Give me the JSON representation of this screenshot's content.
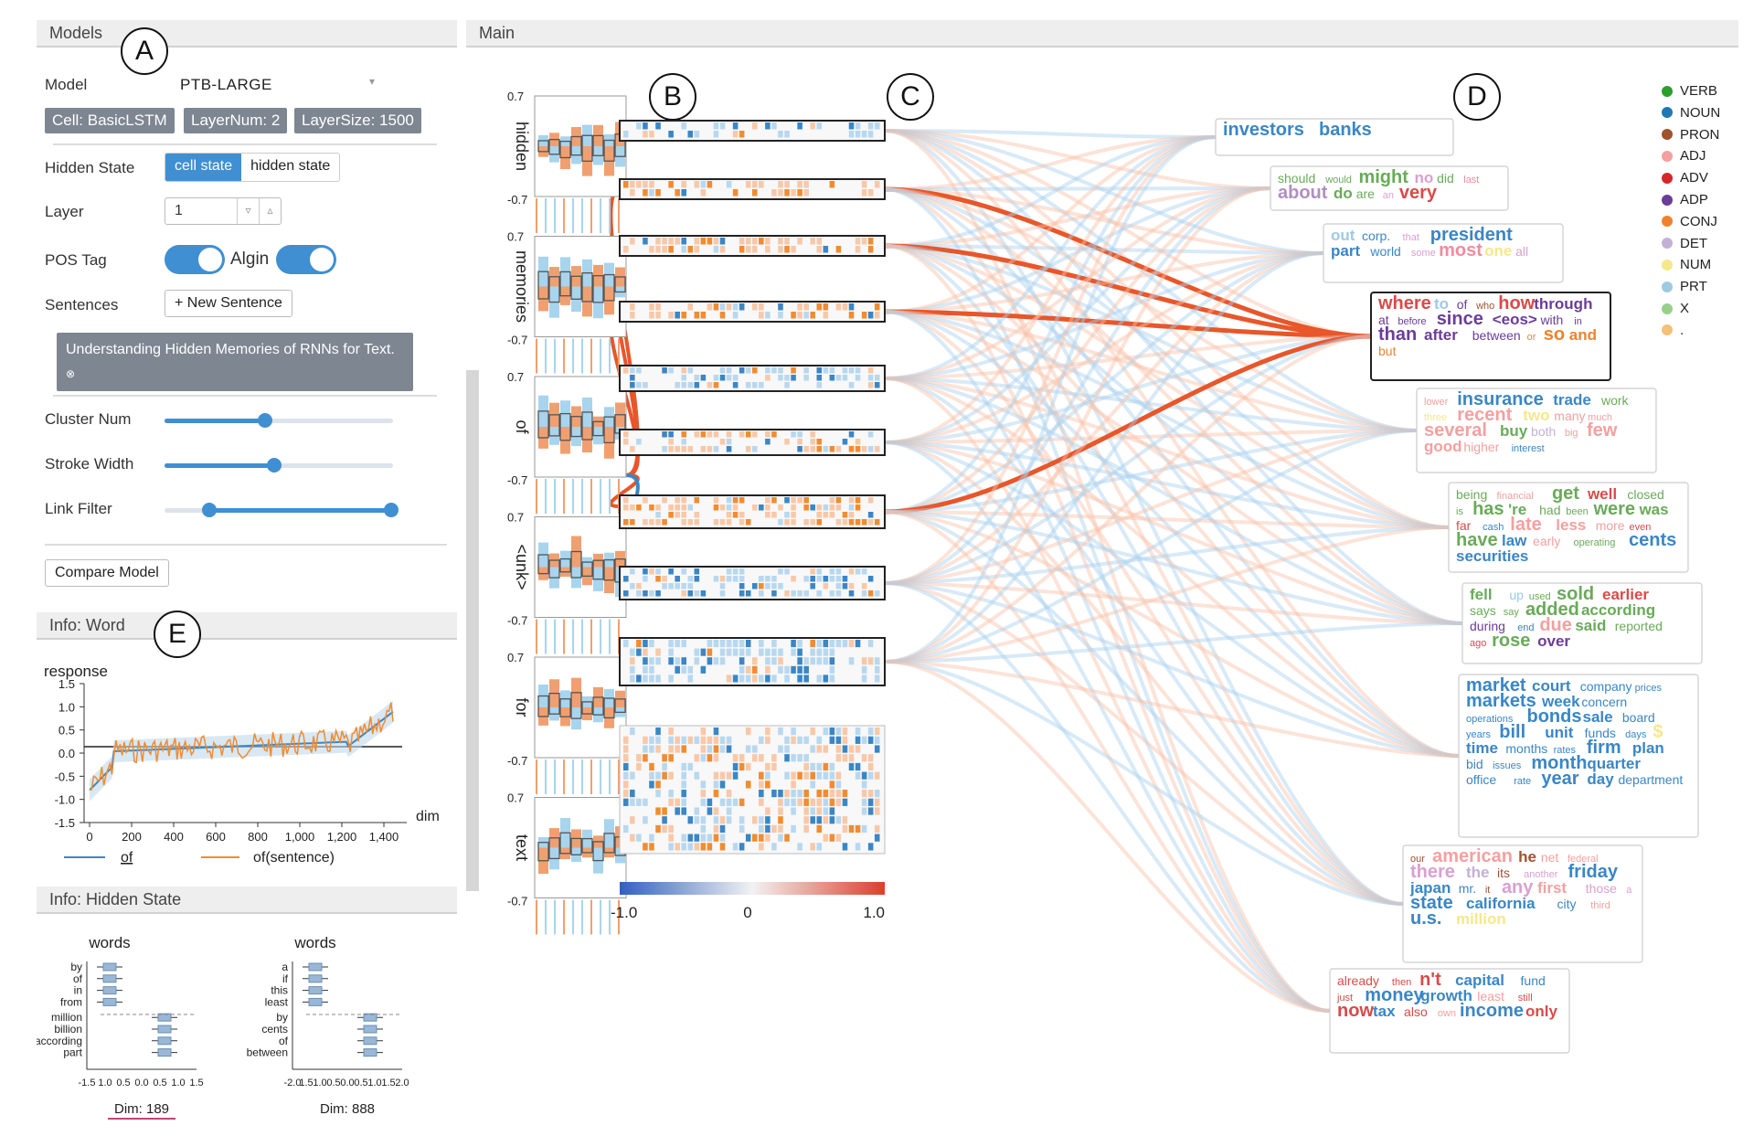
{
  "left": {
    "models_header": "Models",
    "label_a": "A",
    "model_label": "Model",
    "model_value": "PTB-LARGE",
    "chips": [
      "Cell: BasicLSTM",
      "LayerNum: 2",
      "LayerSize: 1500"
    ],
    "hidden_state_label": "Hidden State",
    "hidden_state_options": [
      "cell state",
      "hidden state"
    ],
    "layer_label": "Layer",
    "layer_value": "1",
    "pos_tag_label": "POS Tag",
    "align_label": "Algin",
    "sentences_label": "Sentences",
    "new_sentence_button": "+ New Sentence",
    "sentence_text": "Understanding Hidden Memories of RNNs for Text.",
    "cluster_num_label": "Cluster Num",
    "cluster_num_value": 0.44,
    "stroke_width_label": "Stroke Width",
    "stroke_width_value": 0.48,
    "link_filter_label": "Link Filter",
    "link_filter_range": [
      0.2,
      1.0
    ],
    "compare_button": "Compare Model",
    "info_word_header": "Info: Word",
    "label_e": "E",
    "info_hidden_header": "Info: Hidden State"
  },
  "word_chart": {
    "ylabel": "response",
    "xlabel": "dim",
    "yticks": [
      "1.5",
      "1.0",
      "0.5",
      "0.0",
      "-0.5",
      "-1.0",
      "-1.5"
    ],
    "xticks": [
      "0",
      "200",
      "400",
      "600",
      "800",
      "1,000",
      "1,200",
      "1,400"
    ],
    "legend": [
      "of",
      "of(sentence)"
    ],
    "colors": {
      "of": "#3a86c6",
      "sentence": "#f08c32"
    }
  },
  "box_charts": [
    {
      "title": "words",
      "top_words": [
        "by",
        "of",
        "in",
        "from"
      ],
      "bottom_words": [
        "million",
        "billion",
        "according",
        "part"
      ],
      "xticks": [
        "-1.5",
        "1.0",
        "0.5",
        "0.0",
        "0.5",
        "1.0",
        "1.5"
      ],
      "dim": "Dim: 189"
    },
    {
      "title": "words",
      "top_words": [
        "a",
        "if",
        "this",
        "least"
      ],
      "bottom_words": [
        "by",
        "cents",
        "of",
        "between"
      ],
      "xticks": [
        "-2.0",
        "1.5",
        "1.0",
        "0.5",
        "0.0",
        "0.5",
        "1.0",
        "1.5",
        "2.0"
      ],
      "dim": "Dim: 888"
    }
  ],
  "main": {
    "header": "Main",
    "label_b": "B",
    "label_c": "C",
    "label_d": "D",
    "sequence_words": [
      "hidden",
      "memories",
      "of",
      "<unk>",
      "for",
      "text"
    ],
    "axis_top": "0.7",
    "axis_bottom": "-0.7",
    "colorbar_labels": [
      "-1.0",
      "0",
      "1.0"
    ]
  },
  "pos_legend": [
    {
      "tag": "VERB",
      "color": "#2ca02c"
    },
    {
      "tag": "NOUN",
      "color": "#1f77b4"
    },
    {
      "tag": "PRON",
      "color": "#a0522d"
    },
    {
      "tag": "ADJ",
      "color": "#f4a0a0"
    },
    {
      "tag": "ADV",
      "color": "#d62728"
    },
    {
      "tag": "ADP",
      "color": "#6a3d9a"
    },
    {
      "tag": "CONJ",
      "color": "#f0822d"
    },
    {
      "tag": "DET",
      "color": "#c5b0d5"
    },
    {
      "tag": "NUM",
      "color": "#f5e88a"
    },
    {
      "tag": "PRT",
      "color": "#9ecae1"
    },
    {
      "tag": "X",
      "color": "#98d08a"
    },
    {
      "tag": ".",
      "color": "#f5c078"
    }
  ],
  "word_clouds": [
    {
      "words": [
        [
          "investors",
          "#3a86c6"
        ],
        [
          "banks",
          "#3a86c6"
        ]
      ]
    },
    {
      "words": [
        [
          "should",
          "#6aaa5a"
        ],
        [
          "would",
          "#6aaa5a"
        ],
        [
          "might",
          "#6aaa5a"
        ],
        [
          "no",
          "#d9a0d0"
        ],
        [
          "did",
          "#6aaa5a"
        ],
        [
          "last",
          "#f08ca0"
        ],
        [
          "about",
          "#b08fc0"
        ],
        [
          "do",
          "#6aaa5a"
        ],
        [
          "are",
          "#6aaa5a"
        ],
        [
          "an",
          "#d9a0d0"
        ],
        [
          "very",
          "#d94a4a"
        ]
      ]
    },
    {
      "words": [
        [
          "out",
          "#9ecae1"
        ],
        [
          "corp.",
          "#3a86c6"
        ],
        [
          "that",
          "#d9a0d0"
        ],
        [
          "president",
          "#3a86c6"
        ],
        [
          "part",
          "#3a86c6"
        ],
        [
          "world",
          "#3a86c6"
        ],
        [
          "some",
          "#d9a0d0"
        ],
        [
          "most",
          "#f08ca0"
        ],
        [
          "one",
          "#f5e88a"
        ],
        [
          "all",
          "#d9a0d0"
        ]
      ]
    },
    {
      "words": [
        [
          "where",
          "#d94a4a"
        ],
        [
          "to",
          "#9ecae1"
        ],
        [
          "of",
          "#6a3d9a"
        ],
        [
          "who",
          "#a0522d"
        ],
        [
          "how",
          "#d94a4a"
        ],
        [
          "through",
          "#6a3d9a"
        ],
        [
          "at",
          "#6a3d9a"
        ],
        [
          "before",
          "#6a3d9a"
        ],
        [
          "since",
          "#6a3d9a"
        ],
        [
          "<eos>",
          "#6a3d9a"
        ],
        [
          "with",
          "#6a3d9a"
        ],
        [
          "in",
          "#6a3d9a"
        ],
        [
          "than",
          "#6a3d9a"
        ],
        [
          "after",
          "#6a3d9a"
        ],
        [
          "between",
          "#6a3d9a"
        ],
        [
          "or",
          "#f0822d"
        ],
        [
          "so",
          "#f0822d"
        ],
        [
          "and",
          "#f0822d"
        ],
        [
          "but",
          "#f0822d"
        ]
      ]
    },
    {
      "words": [
        [
          "lower",
          "#f4a0a0"
        ],
        [
          "insurance",
          "#3a86c6"
        ],
        [
          "trade",
          "#3a86c6"
        ],
        [
          "work",
          "#6aaa5a"
        ],
        [
          "three",
          "#f5e88a"
        ],
        [
          "recent",
          "#f4a0a0"
        ],
        [
          "two",
          "#f5e88a"
        ],
        [
          "many",
          "#f4a0a0"
        ],
        [
          "much",
          "#f4a0a0"
        ],
        [
          "several",
          "#f4a0a0"
        ],
        [
          "buy",
          "#6aaa5a"
        ],
        [
          "both",
          "#c5b0d5"
        ],
        [
          "big",
          "#f4a0a0"
        ],
        [
          "few",
          "#f4a0a0"
        ],
        [
          "good",
          "#f4a0a0"
        ],
        [
          "higher",
          "#f4a0a0"
        ],
        [
          "interest",
          "#3a86c6"
        ]
      ]
    },
    {
      "words": [
        [
          "being",
          "#6aaa5a"
        ],
        [
          "financial",
          "#f4a0a0"
        ],
        [
          "get",
          "#6aaa5a"
        ],
        [
          "well",
          "#d94a4a"
        ],
        [
          "closed",
          "#6aaa5a"
        ],
        [
          "is",
          "#6aaa5a"
        ],
        [
          "has",
          "#6aaa5a"
        ],
        [
          "'re",
          "#6aaa5a"
        ],
        [
          "had",
          "#6aaa5a"
        ],
        [
          "been",
          "#6aaa5a"
        ],
        [
          "were",
          "#6aaa5a"
        ],
        [
          "was",
          "#6aaa5a"
        ],
        [
          "far",
          "#d94a4a"
        ],
        [
          "cash",
          "#3a86c6"
        ],
        [
          "late",
          "#f4a0a0"
        ],
        [
          "less",
          "#f4a0a0"
        ],
        [
          "more",
          "#f4a0a0"
        ],
        [
          "even",
          "#d94a4a"
        ],
        [
          "have",
          "#6aaa5a"
        ],
        [
          "law",
          "#3a86c6"
        ],
        [
          "early",
          "#f4a0a0"
        ],
        [
          "operating",
          "#6aaa5a"
        ],
        [
          "cents",
          "#3a86c6"
        ],
        [
          "securities",
          "#3a86c6"
        ]
      ]
    },
    {
      "words": [
        [
          "fell",
          "#6aaa5a"
        ],
        [
          "up",
          "#9ecae1"
        ],
        [
          "used",
          "#6aaa5a"
        ],
        [
          "sold",
          "#6aaa5a"
        ],
        [
          "earlier",
          "#d94a4a"
        ],
        [
          "says",
          "#6aaa5a"
        ],
        [
          "say",
          "#6aaa5a"
        ],
        [
          "added",
          "#6aaa5a"
        ],
        [
          "according",
          "#6aaa5a"
        ],
        [
          "during",
          "#6a3d9a"
        ],
        [
          "end",
          "#3a86c6"
        ],
        [
          "due",
          "#f4a0a0"
        ],
        [
          "said",
          "#6aaa5a"
        ],
        [
          "reported",
          "#6aaa5a"
        ],
        [
          "ago",
          "#d94a4a"
        ],
        [
          "rose",
          "#6aaa5a"
        ],
        [
          "over",
          "#6a3d9a"
        ]
      ]
    },
    {
      "words": [
        [
          "market",
          "#3a86c6"
        ],
        [
          "court",
          "#3a86c6"
        ],
        [
          "company",
          "#3a86c6"
        ],
        [
          "prices",
          "#3a86c6"
        ],
        [
          "markets",
          "#3a86c6"
        ],
        [
          "week",
          "#3a86c6"
        ],
        [
          "concern",
          "#3a86c6"
        ],
        [
          "operations",
          "#3a86c6"
        ],
        [
          "bonds",
          "#3a86c6"
        ],
        [
          "sale",
          "#3a86c6"
        ],
        [
          "board",
          "#3a86c6"
        ],
        [
          "years",
          "#3a86c6"
        ],
        [
          "bill",
          "#3a86c6"
        ],
        [
          "unit",
          "#3a86c6"
        ],
        [
          "funds",
          "#3a86c6"
        ],
        [
          "days",
          "#3a86c6"
        ],
        [
          "$",
          "#f5e88a"
        ],
        [
          "time",
          "#3a86c6"
        ],
        [
          "months",
          "#3a86c6"
        ],
        [
          "rates",
          "#3a86c6"
        ],
        [
          "firm",
          "#3a86c6"
        ],
        [
          "plan",
          "#3a86c6"
        ],
        [
          "bid",
          "#3a86c6"
        ],
        [
          "issues",
          "#3a86c6"
        ],
        [
          "month",
          "#3a86c6"
        ],
        [
          "quarter",
          "#3a86c6"
        ],
        [
          "office",
          "#3a86c6"
        ],
        [
          "rate",
          "#3a86c6"
        ],
        [
          "year",
          "#3a86c6"
        ],
        [
          "day",
          "#3a86c6"
        ],
        [
          "department",
          "#3a86c6"
        ]
      ]
    },
    {
      "words": [
        [
          "our",
          "#a0522d"
        ],
        [
          "american",
          "#f4a0a0"
        ],
        [
          "he",
          "#a0522d"
        ],
        [
          "net",
          "#f4a0a0"
        ],
        [
          "federal",
          "#f4a0a0"
        ],
        [
          "there",
          "#d9a0d0"
        ],
        [
          "the",
          "#c5b0d5"
        ],
        [
          "its",
          "#a0522d"
        ],
        [
          "another",
          "#d9a0d0"
        ],
        [
          "friday",
          "#3a86c6"
        ],
        [
          "japan",
          "#3a86c6"
        ],
        [
          "mr.",
          "#3a86c6"
        ],
        [
          "it",
          "#a0522d"
        ],
        [
          "any",
          "#d9a0d0"
        ],
        [
          "first",
          "#f4a0a0"
        ],
        [
          "those",
          "#d9a0d0"
        ],
        [
          "a",
          "#d9a0d0"
        ],
        [
          "state",
          "#3a86c6"
        ],
        [
          "california",
          "#3a86c6"
        ],
        [
          "city",
          "#3a86c6"
        ],
        [
          "third",
          "#f4a0a0"
        ],
        [
          "u.s.",
          "#3a86c6"
        ],
        [
          "million",
          "#f5e88a"
        ]
      ]
    },
    {
      "words": [
        [
          "already",
          "#d94a4a"
        ],
        [
          "then",
          "#d94a4a"
        ],
        [
          "n't",
          "#d94a4a"
        ],
        [
          "capital",
          "#3a86c6"
        ],
        [
          "fund",
          "#3a86c6"
        ],
        [
          "just",
          "#d94a4a"
        ],
        [
          "money",
          "#3a86c6"
        ],
        [
          "growth",
          "#3a86c6"
        ],
        [
          "least",
          "#f4a0a0"
        ],
        [
          "still",
          "#d94a4a"
        ],
        [
          "now",
          "#d94a4a"
        ],
        [
          "tax",
          "#3a86c6"
        ],
        [
          "also",
          "#d94a4a"
        ],
        [
          "own",
          "#f4a0a0"
        ],
        [
          "income",
          "#3a86c6"
        ],
        [
          "only",
          "#d94a4a"
        ]
      ]
    }
  ]
}
